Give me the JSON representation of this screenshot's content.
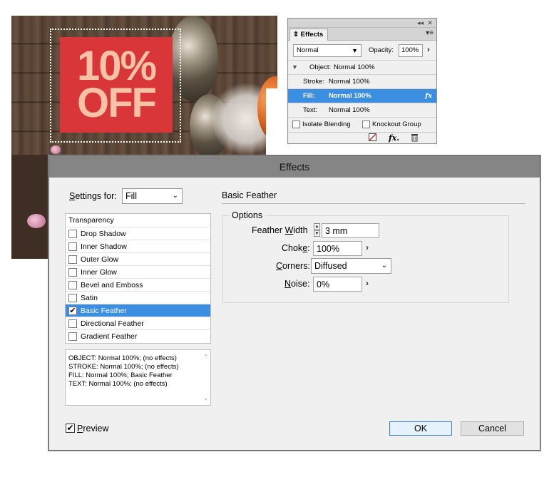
{
  "promo": {
    "line1": "10%",
    "line2": "OFF"
  },
  "effects_panel": {
    "collapse_glyph": "◂◂",
    "close_glyph": "✕",
    "tab_label": "Effects",
    "tab_icon": "⇕",
    "menu_glyph": "▾≡",
    "blend_mode": "Normal",
    "opacity_label": "Opacity:",
    "opacity_value": "100%",
    "rows": [
      {
        "name": "Object:",
        "mode": "Normal 100%"
      },
      {
        "name": "Stroke:",
        "mode": "Normal 100%"
      },
      {
        "name": "Fill:",
        "mode": "Normal 100%",
        "fx": "fx"
      },
      {
        "name": "Text:",
        "mode": "Normal 100%"
      }
    ],
    "isolate_label": "Isolate Blending",
    "knockout_label": "Knockout Group",
    "footer_fx_glyph": "fx.",
    "clear_icon": "clear-effects-icon",
    "trash_icon": "trash-icon"
  },
  "dialog": {
    "title": "Effects",
    "settings_for_label": "Settings for:",
    "settings_for_value": "Fill",
    "section_title": "Basic Feather",
    "list": {
      "header": "Transparency",
      "items": [
        {
          "label": "Drop Shadow",
          "checked": false
        },
        {
          "label": "Inner Shadow",
          "checked": false
        },
        {
          "label": "Outer Glow",
          "checked": false
        },
        {
          "label": "Inner Glow",
          "checked": false
        },
        {
          "label": "Bevel and Emboss",
          "checked": false
        },
        {
          "label": "Satin",
          "checked": false
        },
        {
          "label": "Basic Feather",
          "checked": true
        },
        {
          "label": "Directional Feather",
          "checked": false
        },
        {
          "label": "Gradient Feather",
          "checked": false
        }
      ]
    },
    "summary": [
      "OBJECT: Normal 100%; (no effects)",
      "STROKE: Normal 100%; (no effects)",
      "FILL: Normal 100%; Basic Feather",
      "TEXT: Normal 100%; (no effects)"
    ],
    "options": {
      "group_label": "Options",
      "feather_width_label": "Feather Width",
      "feather_width_value": "3 mm",
      "choke_label": "Choke:",
      "choke_value": "100%",
      "corners_label": "Corners:",
      "corners_value": "Diffused",
      "noise_label": "Noise:",
      "noise_value": "0%"
    },
    "preview_label": "Preview",
    "preview_checked": true,
    "ok_label": "OK",
    "cancel_label": "Cancel"
  },
  "colors": {
    "selection": "#3c8ee0",
    "promo_red": "#d9363a",
    "promo_text": "#f7c2a6",
    "dialog_titlebar": "#858585"
  }
}
